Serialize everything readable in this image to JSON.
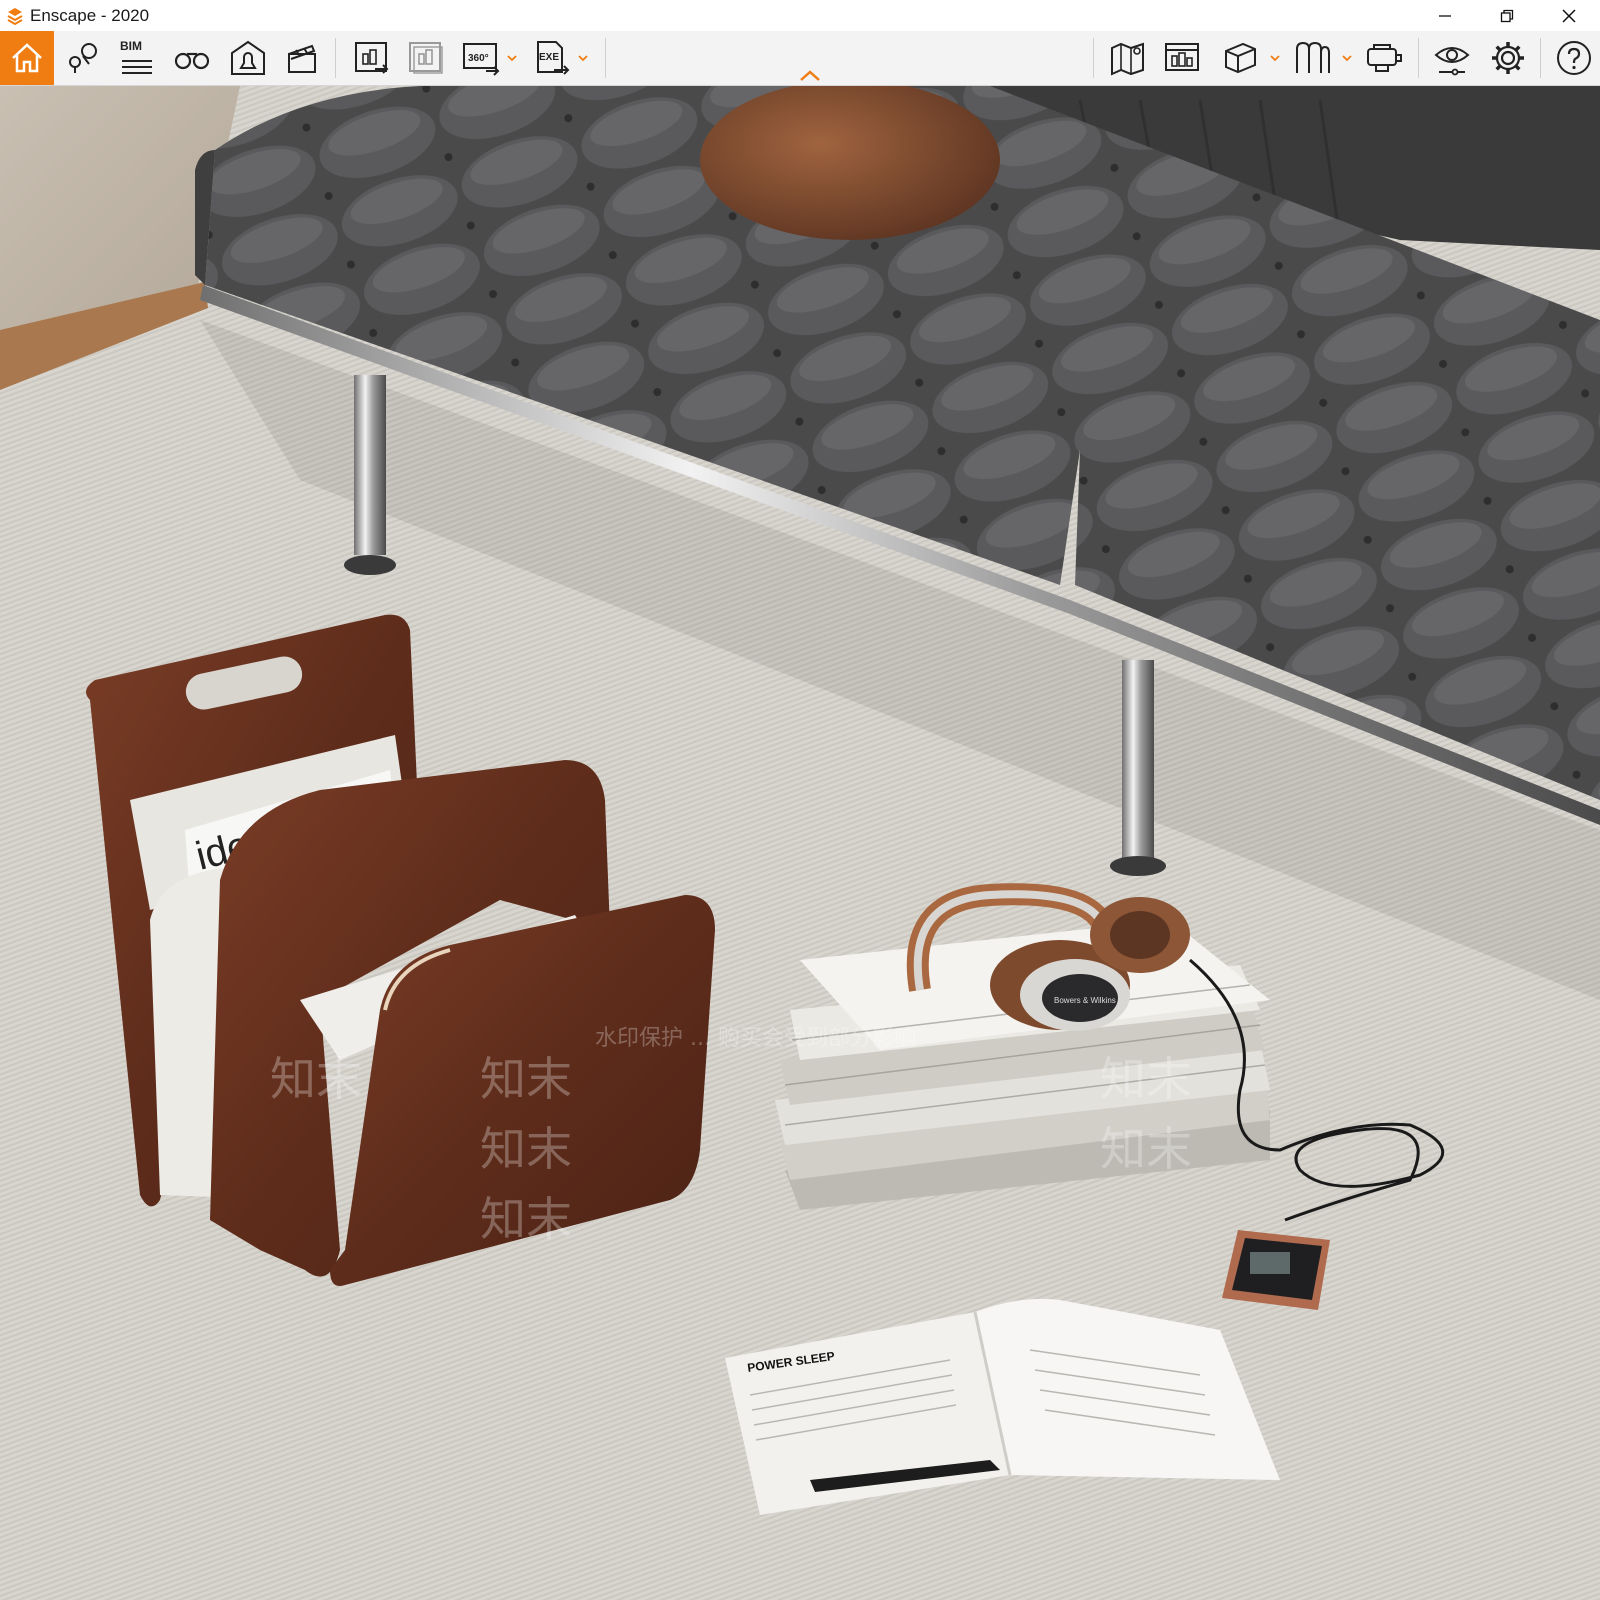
{
  "window": {
    "title": "Enscape - 2020",
    "controls": [
      "minimize-icon",
      "restore-icon",
      "close-icon"
    ]
  },
  "toolbar": {
    "accent_color": "#f07d12",
    "bim_label": "BIM",
    "left_group": [
      {
        "name": "home-icon",
        "active": true
      },
      {
        "name": "location-pin-icon"
      },
      {
        "name": "bim-icon"
      },
      {
        "name": "binoculars-icon"
      },
      {
        "name": "house-bell-icon"
      },
      {
        "name": "clapperboard-icon"
      }
    ],
    "export_group": [
      {
        "name": "render-screenshot-icon"
      },
      {
        "name": "batch-render-icon"
      },
      {
        "name": "panorama-360-icon",
        "dropdown": true
      },
      {
        "name": "export-exe-icon",
        "dropdown": true
      }
    ],
    "right_group": [
      {
        "name": "map-icon"
      },
      {
        "name": "asset-library-icon"
      },
      {
        "name": "cube-view-icon",
        "dropdown": true
      },
      {
        "name": "vr-icon",
        "dropdown": true
      },
      {
        "name": "vr-headset-icon"
      },
      {
        "name": "visual-settings-icon"
      },
      {
        "name": "gear-icon"
      },
      {
        "name": "help-icon"
      }
    ]
  },
  "render": {
    "magazine_cover_text": "identity",
    "open_magazine_heading": "POWER SLEEP",
    "headphone_brand": "Bowers & Wilkins",
    "watermark_line": "水印保护 ... 购买会受到部分影响",
    "watermark_brand": "知末"
  }
}
